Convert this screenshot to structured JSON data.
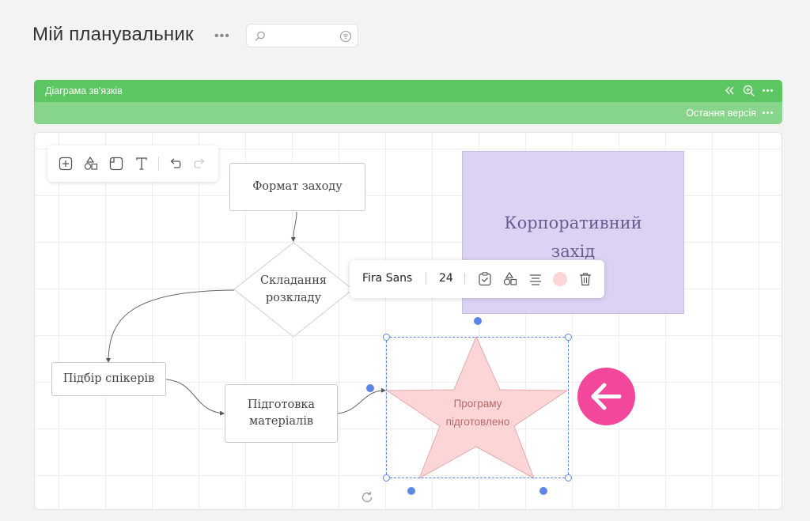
{
  "page": {
    "title": "Мій планувальник"
  },
  "search": {
    "value": "",
    "placeholder": ""
  },
  "board": {
    "name": "Діаграма зв'язків",
    "version_label": "Остання версія"
  },
  "toolbar": {
    "tools": [
      "add-shape-icon",
      "shapes-icon",
      "sticky-note-icon",
      "text-icon",
      "undo-icon",
      "redo-icon"
    ]
  },
  "diagram": {
    "nodes": {
      "event_format": "Формат заходу",
      "schedule": [
        "Складання",
        "розкладу"
      ],
      "speakers": "Підбір спікерів",
      "materials": [
        "Підготовка",
        "матеріалів"
      ],
      "corporate_event": [
        "Корпоративний",
        "захід"
      ],
      "program_ready": [
        "Програму",
        "підготовлено"
      ]
    }
  },
  "format_toolbar": {
    "font": "Fira Sans",
    "size": "24",
    "fill_color": "#fcd6d6"
  },
  "colors": {
    "header_green": "#5cc662",
    "version_green": "#86d58a",
    "sticky_purple": "#dcd3f4",
    "star_fill": "#fcd6d6",
    "accent_pink": "#f2479b",
    "selection_blue": "#5b86e5"
  }
}
